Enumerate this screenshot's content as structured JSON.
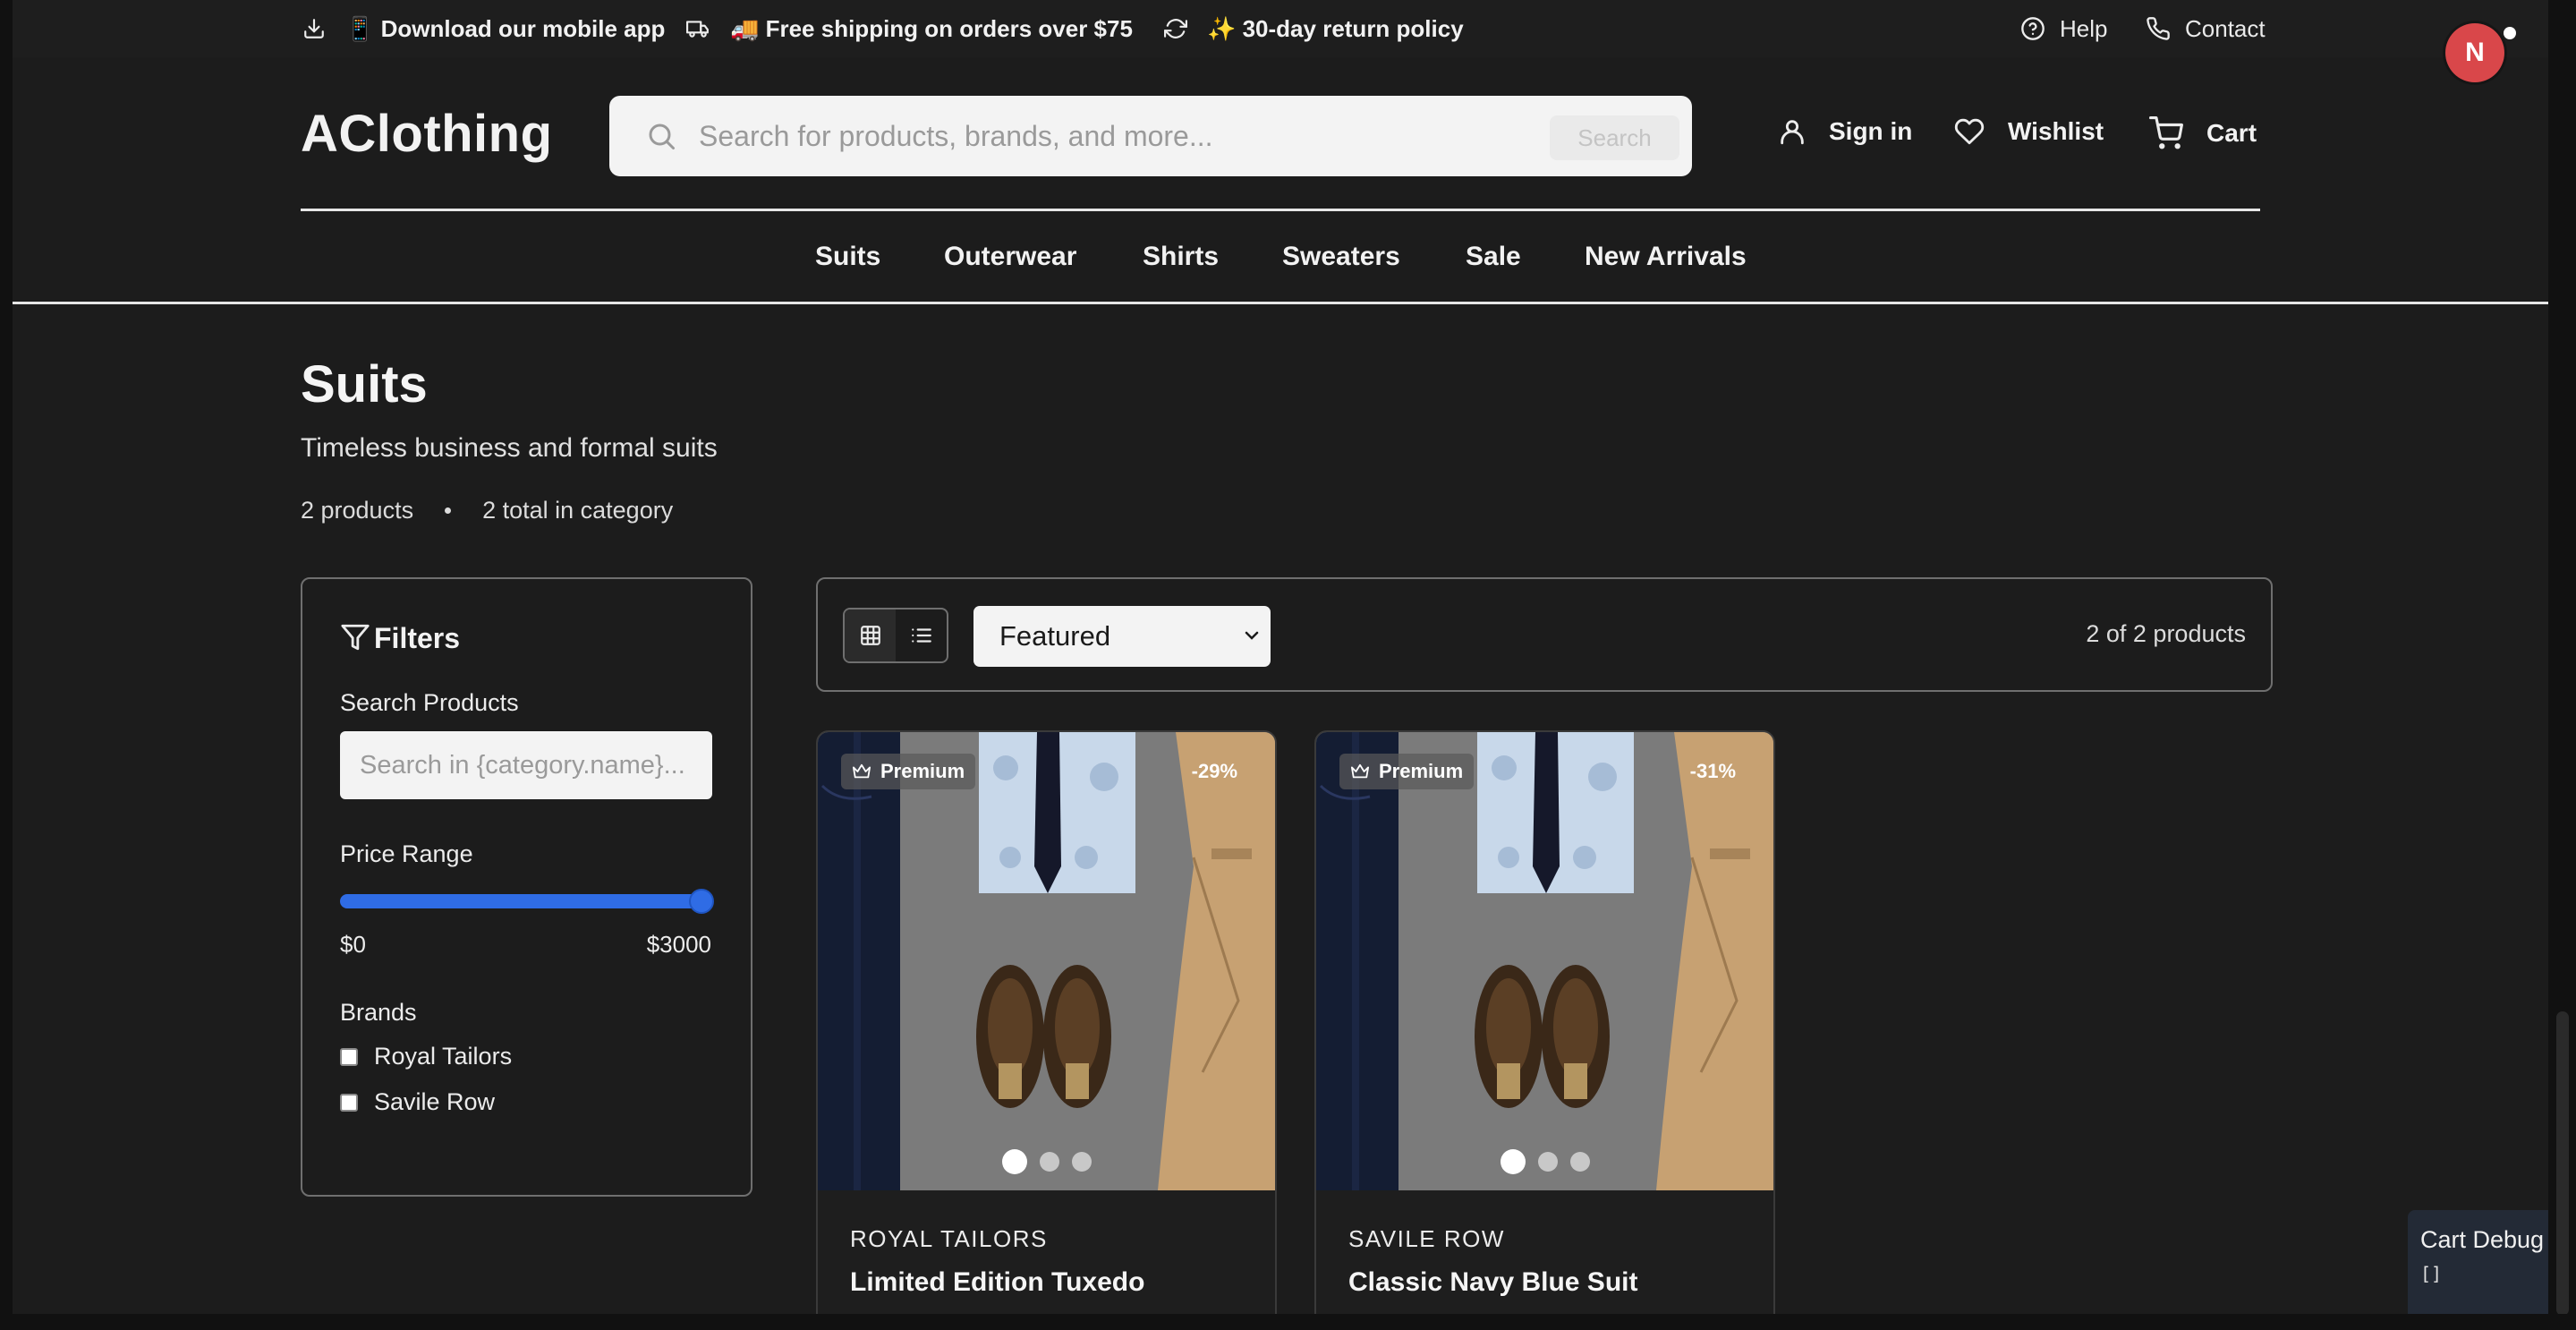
{
  "topbar": {
    "promos": [
      {
        "icon": "download-icon",
        "text": "📱 Download our mobile app"
      },
      {
        "icon": "truck-icon",
        "text": "🚚 Free shipping on orders over $75"
      },
      {
        "icon": "refresh-icon",
        "text": "✨ 30-day return policy"
      }
    ],
    "help": "Help",
    "contact": "Contact"
  },
  "user": {
    "avatar_initial": "N"
  },
  "header": {
    "logo": "AClothing",
    "search_placeholder": "Search for products, brands, and more...",
    "search_button": "Search",
    "sign_in": "Sign in",
    "wishlist": "Wishlist",
    "cart": "Cart"
  },
  "nav": {
    "items": [
      "Suits",
      "Outerwear",
      "Shirts",
      "Sweaters",
      "Sale",
      "New Arrivals"
    ]
  },
  "category": {
    "title": "Suits",
    "description": "Timeless business and formal suits",
    "product_count": "2 products",
    "total_in_category": "2 total in category"
  },
  "filters": {
    "title": "Filters",
    "search_label": "Search Products",
    "search_placeholder": "Search in {category.name}...",
    "price_label": "Price Range",
    "price_min": "$0",
    "price_max": "$3000",
    "price_fill": 1.0,
    "brands_label": "Brands",
    "brands": [
      {
        "label": "Royal Tailors",
        "checked": false
      },
      {
        "label": "Savile Row",
        "checked": false
      }
    ]
  },
  "toolbar": {
    "active_view": "grid",
    "sort_value": "Featured",
    "result_count": "2 of 2 products"
  },
  "products": [
    {
      "badge": "Premium",
      "discount": "-29%",
      "brand": "ROYAL TAILORS",
      "name": "Limited Edition Tuxedo",
      "image_dots": 3,
      "active_dot": 0
    },
    {
      "badge": "Premium",
      "discount": "-31%",
      "brand": "SAVILE ROW",
      "name": "Classic Navy Blue Suit",
      "image_dots": 3,
      "active_dot": 0
    }
  ],
  "cart_debug": {
    "title": "Cart Debug",
    "content": "[]"
  },
  "colors": {
    "background": "#1c1c1c",
    "accent": "#2f6ce5",
    "avatar": "#d9474a"
  }
}
